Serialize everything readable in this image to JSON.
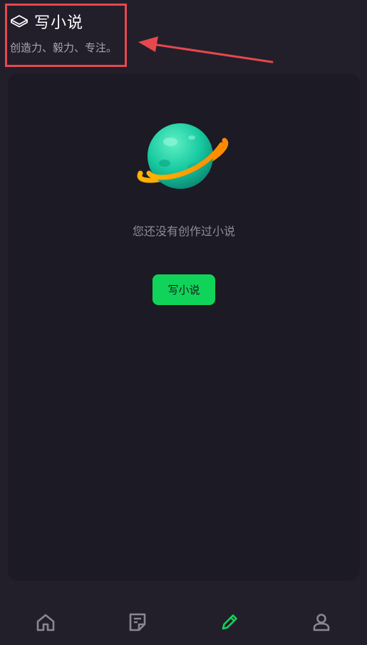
{
  "header": {
    "icon": "book-icon",
    "title": "写小说",
    "subtitle": "创造力、毅力、专注。"
  },
  "empty_state": {
    "illustration": "planet-icon",
    "message": "您还没有创作过小说",
    "button_label": "写小说"
  },
  "bottom_nav": {
    "items": [
      {
        "icon": "home-icon",
        "active": false
      },
      {
        "icon": "note-icon",
        "active": false
      },
      {
        "icon": "pencil-icon",
        "active": true
      },
      {
        "icon": "user-icon",
        "active": false
      }
    ]
  },
  "colors": {
    "background": "#221f2b",
    "card": "#1c1a24",
    "accent": "#10d45a",
    "annotation": "#e5484d",
    "nav_inactive": "#8a8794"
  }
}
